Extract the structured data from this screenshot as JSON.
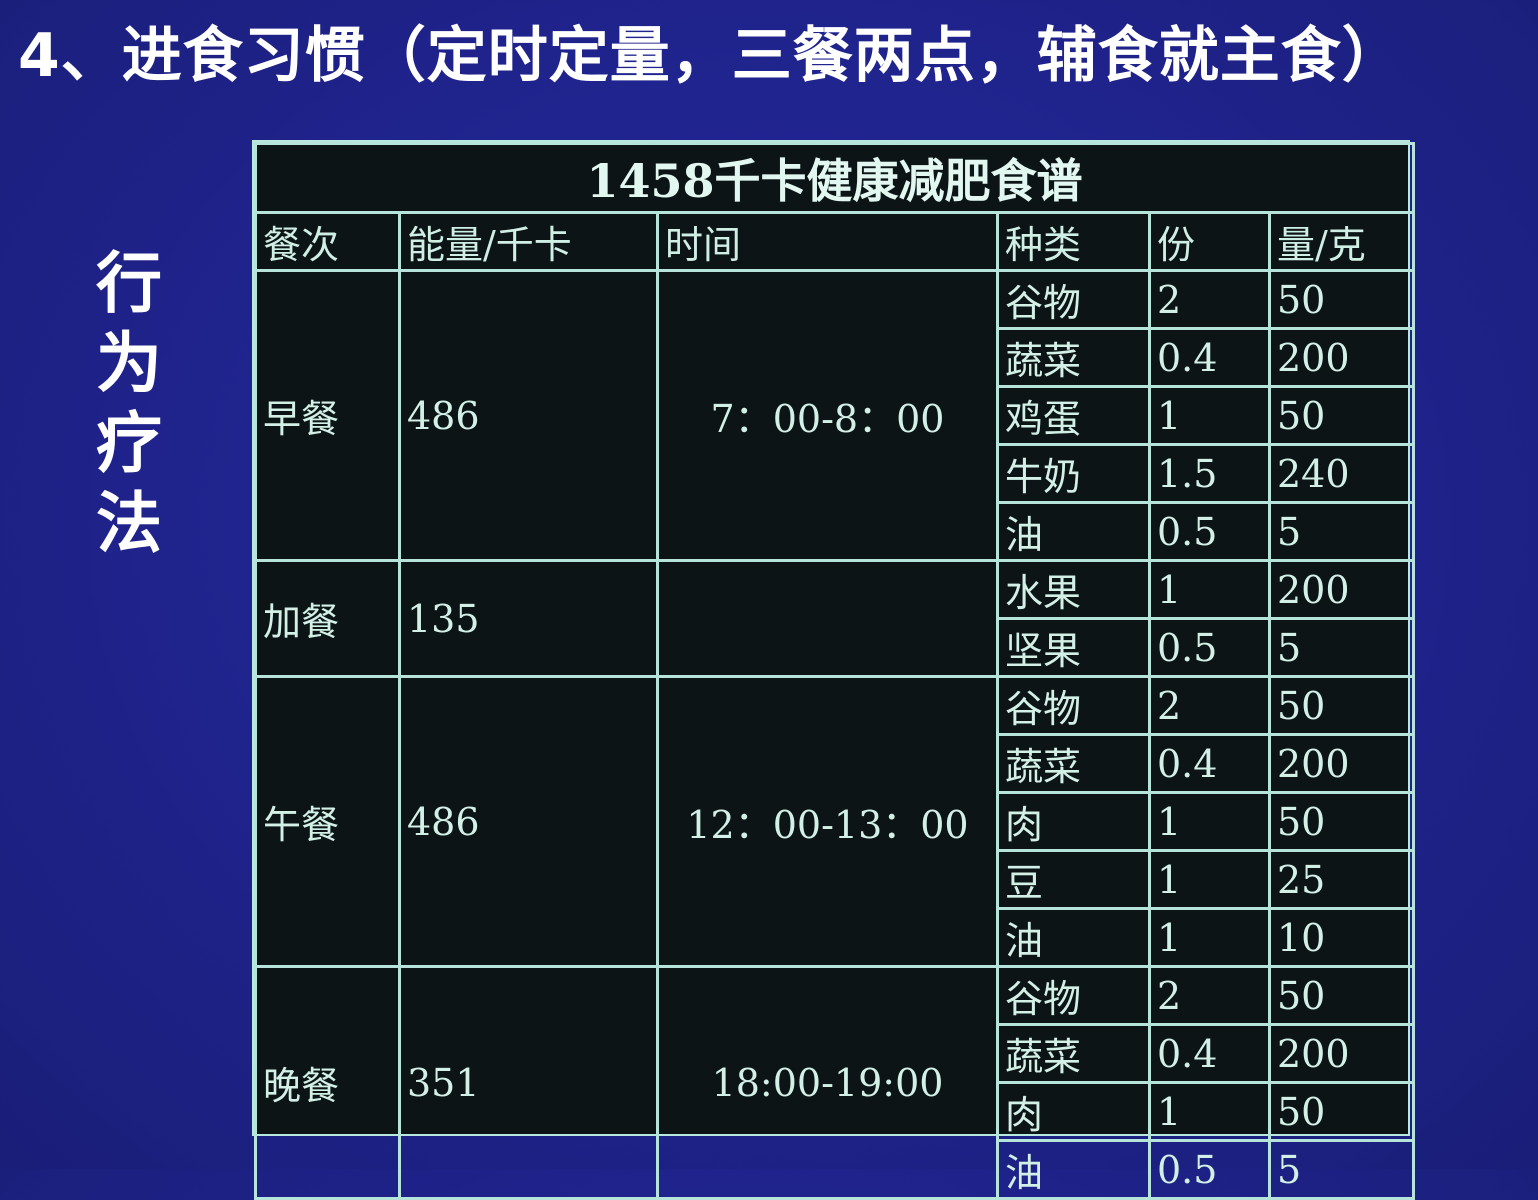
{
  "slide": {
    "heading": "4、进食习惯（定时定量，三餐两点，辅食就主食）",
    "side_label": "行为疗法"
  },
  "table": {
    "title": "1458千卡健康减肥食谱",
    "headers": {
      "meal": "餐次",
      "energy": "能量/千卡",
      "time": "时间",
      "type": "种类",
      "portion": "份",
      "amount": "量/克"
    },
    "meals": [
      {
        "meal": "早餐",
        "energy": "486",
        "time": "7：00-8：00",
        "items": [
          {
            "type": "谷物",
            "portion": "2",
            "amount": "50"
          },
          {
            "type": "蔬菜",
            "portion": "0.4",
            "amount": "200"
          },
          {
            "type": "鸡蛋",
            "portion": "1",
            "amount": "50"
          },
          {
            "type": "牛奶",
            "portion": "1.5",
            "amount": "240"
          },
          {
            "type": "油",
            "portion": "0.5",
            "amount": "5"
          }
        ]
      },
      {
        "meal": "加餐",
        "energy": "135",
        "time": "",
        "items": [
          {
            "type": "水果",
            "portion": "1",
            "amount": "200"
          },
          {
            "type": "坚果",
            "portion": "0.5",
            "amount": "5"
          }
        ]
      },
      {
        "meal": "午餐",
        "energy": "486",
        "time": "12：00-13：00",
        "items": [
          {
            "type": "谷物",
            "portion": "2",
            "amount": "50"
          },
          {
            "type": "蔬菜",
            "portion": "0.4",
            "amount": "200"
          },
          {
            "type": "肉",
            "portion": "1",
            "amount": "50"
          },
          {
            "type": "豆",
            "portion": "1",
            "amount": "25"
          },
          {
            "type": "油",
            "portion": "1",
            "amount": "10"
          }
        ]
      },
      {
        "meal": "晚餐",
        "energy": "351",
        "time": "18:00-19:00",
        "items": [
          {
            "type": "谷物",
            "portion": "2",
            "amount": "50"
          },
          {
            "type": "蔬菜",
            "portion": "0.4",
            "amount": "200"
          },
          {
            "type": "肉",
            "portion": "1",
            "amount": "50"
          },
          {
            "type": "油",
            "portion": "0.5",
            "amount": "5"
          }
        ]
      }
    ]
  }
}
